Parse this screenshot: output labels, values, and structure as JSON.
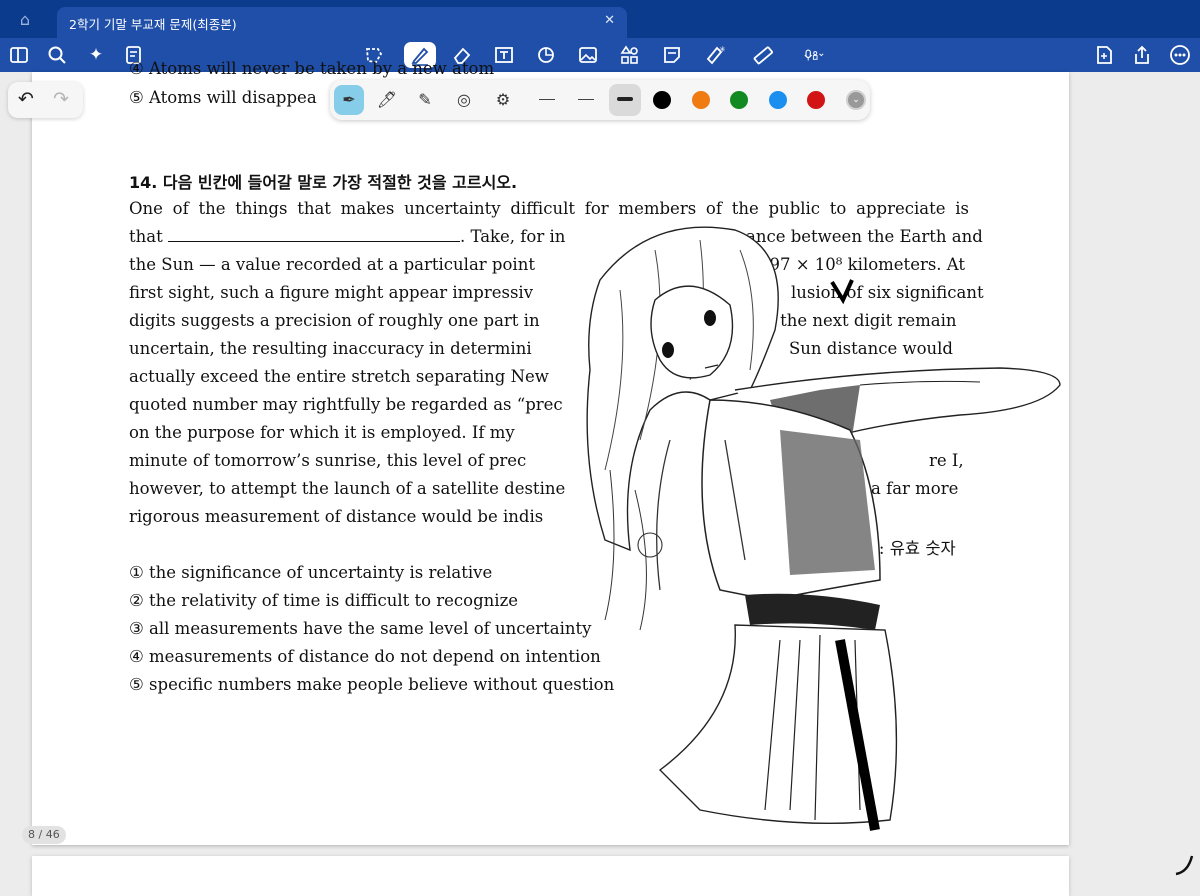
{
  "tab": {
    "title": "2학기 기말 부교재 문제(최종본)"
  },
  "toolbar": {
    "icons": [
      "sidebar-icon",
      "search-icon",
      "ai-sparkle-icon",
      "notes-icon",
      "lasso-icon",
      "pen-icon",
      "eraser-icon",
      "textbox-icon",
      "shapes-icon",
      "image-icon",
      "elements-icon",
      "sticky-note-icon",
      "highlighter-icon",
      "ruler-icon",
      "microphone-icon",
      "add-page-icon",
      "share-icon",
      "more-icon"
    ]
  },
  "pen_panel": {
    "colors": [
      "#000000",
      "#f07b11",
      "#128a22",
      "#1a8fef",
      "#d21414"
    ],
    "more_label": "⌄"
  },
  "document": {
    "top_cut": "④ Atoms will never be taken by a new atom",
    "option5_prev": "⑤ Atoms will disappea",
    "question_title": "14. 다음 빈칸에 들어갈 말로 가장 적절한 것을 고르시오.",
    "lines": [
      " One of the things that makes uncertainty difficult for members of the public to appreciate is",
      "that ",
      ". Take, for in",
      "ance between the Earth and",
      "the Sun — a value recorded at a particular point",
      "597 × 10⁸ kilometers. At",
      "first sight, such a figure might appear impressiv",
      "lusion of six significant",
      "digits suggests a precision of roughly one part in",
      "ld the next digit remain",
      "uncertain, the resulting inaccuracy in determini",
      "Sun distance would",
      "actually exceed the entire stretch separating New",
      "quoted number may rightfully be regarded as “prec",
      "on the purpose for which it is employed. If my",
      "minute of tomorrow’s sunrise, this level of prec",
      "re I,",
      "however, to attempt the launch of a satellite destine",
      "a far more",
      "rigorous measurement of distance would be indis",
      "it: 유효 숫자"
    ],
    "options": [
      "① the significance of uncertainty is relative",
      "② the relativity of time is difficult to recognize",
      "③ all measurements have the same level of uncertainty",
      "④ measurements of distance do not depend on intention",
      "⑤ specific numbers make people believe without question"
    ]
  },
  "page_indicator": "8 / 46"
}
